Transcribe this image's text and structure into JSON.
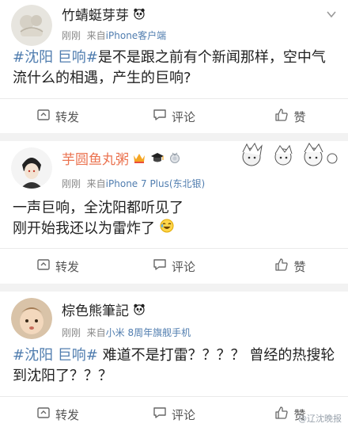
{
  "posts": [
    {
      "username": "竹蜻蜓芽芽",
      "time": "刚刚",
      "source_prefix": "来自",
      "source": "iPhone客户端",
      "topic": "#沈阳 巨响#",
      "text": "是不是跟之前有个新闻那样，空中气流什么的相遇，产生的巨响?",
      "actions": {
        "repost": "转发",
        "comment": "评论",
        "like": "赞"
      }
    },
    {
      "username": "芋圆鱼丸粥",
      "time": "刚刚",
      "source_prefix": "来自",
      "source": "iPhone 7 Plus(东北银)",
      "text_line1": "一声巨响，全沈阳都听见了",
      "text_line2": "刚开始我还以为雷炸了",
      "actions": {
        "repost": "转发",
        "comment": "评论",
        "like": "赞"
      }
    },
    {
      "username": "棕色熊筆記",
      "time": "刚刚",
      "source_prefix": "来自",
      "source": "小米 8周年旗舰手机",
      "topic": "#沈阳 巨响#",
      "text": " 难道不是打雷？？？？ 曾经的热搜轮到沈阳了？？？",
      "actions": {
        "repost": "转发",
        "comment": "评论",
        "like": "赞"
      }
    }
  ],
  "watermark": "@辽沈晚报",
  "colors": {
    "link": "#507daf",
    "name_orange": "#eb7350",
    "meta": "#888888",
    "divider": "#f2f2f2"
  },
  "icons": [
    "panda-icon",
    "chevron-down-icon",
    "repost-icon",
    "comment-icon",
    "like-icon",
    "crown-icon",
    "grad-cap-icon",
    "medal-icon",
    "emoji-laugh-icon"
  ]
}
